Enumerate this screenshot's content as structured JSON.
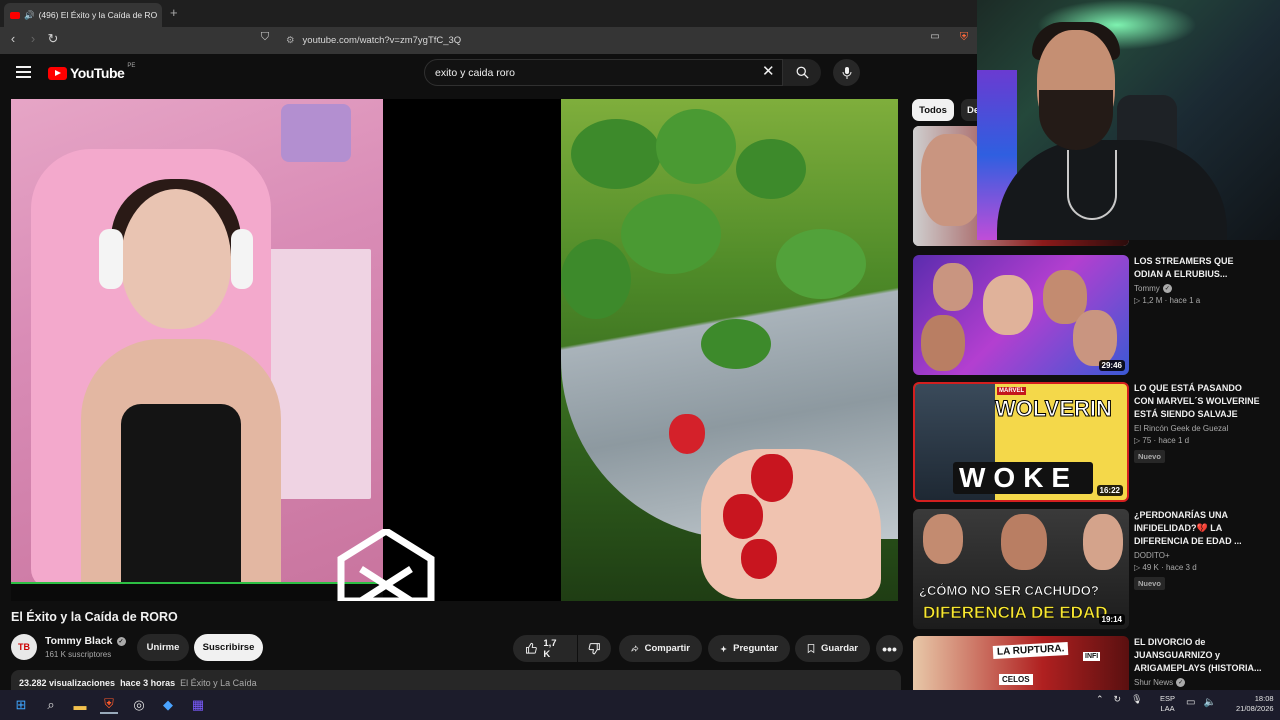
{
  "browser": {
    "tab_title": "(496) El Éxito y la Caída de RO",
    "url": "youtube.com/watch?v=zm7ygTfC_3Q"
  },
  "youtube": {
    "logo_text": "YouTube",
    "country_code": "PE",
    "search_query": "exito y caida roro"
  },
  "video": {
    "title": "El Éxito y la Caída de RORO",
    "channel": "Tommy Black",
    "subscribers": "161 K suscriptores",
    "join_label": "Unirme",
    "subscribe_label": "Suscribirse",
    "likes": "1,7 K",
    "share_label": "Compartir",
    "ask_label": "Preguntar",
    "save_label": "Guardar",
    "views": "23.282 visualizaciones",
    "published": "hace 3 horas",
    "desc_snippet": "El Éxito y La Caída"
  },
  "sidebar": {
    "chips": [
      "Todos",
      "De"
    ],
    "videos": [
      {
        "title": "LOS STREAMERS QUE ODIAN A ELRUBIUS...",
        "channel": "Tommy",
        "views": "1,2 M",
        "age": "hace 1 a",
        "duration": "29:46",
        "badge": ""
      },
      {
        "title": "LO QUE ESTÁ PASANDO CON MARVEL´S WOLVERINE ESTÁ SIENDO SALVAJE",
        "channel": "El Rincón Geek de Guezal",
        "views": "75",
        "age": "hace 1 d",
        "duration": "16:22",
        "badge": "Nuevo",
        "thumb_text_1": "WOLVERIN",
        "thumb_text_2": "WOKE",
        "thumb_brand": "MARVEL"
      },
      {
        "title": "¿PERDONARÍAS UNA INFIDELIDAD?💔 LA DIFERENCIA DE EDAD ...",
        "channel": "DODITO+",
        "views": "49 K",
        "age": "hace 3 d",
        "duration": "19:14",
        "badge": "Nuevo",
        "thumb_text_1": "¿CÓMO NO SER CACHUDO?",
        "thumb_text_2": "DIFERENCIA DE EDAD"
      },
      {
        "title": "EL DIVORCIO de JUANSGUARNIZO y ARIGAMEPLAYS (HISTORIA...",
        "channel": "Shur News",
        "views": "",
        "age": "",
        "duration": "",
        "badge": "",
        "thumb_text_1": "LA RUPTURA.",
        "thumb_text_2": "CELOS",
        "thumb_text_3": "INFI"
      }
    ]
  },
  "taskbar": {
    "lang_line1": "ESP",
    "lang_line2": "LAA",
    "time": "18:08",
    "date": "21/08/2026"
  },
  "icons": {
    "search": "search-icon",
    "mic": "mic-icon",
    "like": "thumbs-up-icon",
    "dislike": "thumbs-down-icon",
    "share": "share-icon",
    "ask": "sparkle-icon",
    "save": "bookmark-icon"
  },
  "colors": {
    "youtube_red": "#ff0000",
    "background": "#0f0f0f",
    "pill": "#272727"
  }
}
